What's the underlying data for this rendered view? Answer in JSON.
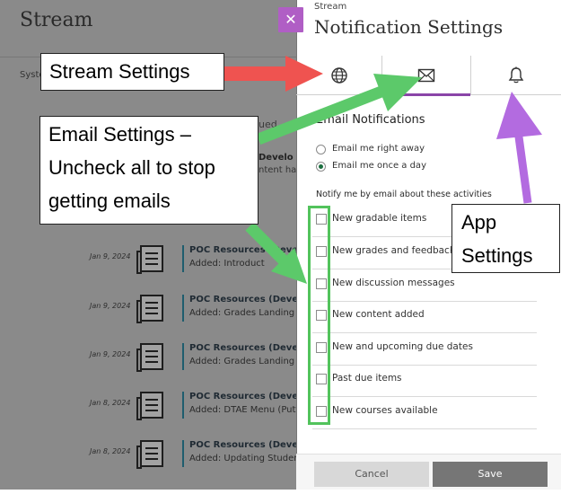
{
  "stream": {
    "title": "Stream",
    "system_tab": "Syste",
    "fragment_1": "ued",
    "fragment_2": "Develo",
    "fragment_3": "ntent has",
    "rows": [
      {
        "date": "Jan 9, 2024",
        "title": "POC Resources (Develo",
        "subtitle": "Added: Introduct"
      },
      {
        "date": "Jan 9, 2024",
        "title": "POC Resources (Develo",
        "subtitle": "Added: Grades Landing P"
      },
      {
        "date": "Jan 9, 2024",
        "title": "POC Resources (Develo",
        "subtitle": "Added: Grades Landing P"
      },
      {
        "date": "Jan 8, 2024",
        "title": "POC Resources (Develo",
        "subtitle": "Added: DTAE Menu (Putty"
      },
      {
        "date": "Jan 8, 2024",
        "title": "POC Resources (Develo",
        "subtitle": "Added: Updating Studen"
      }
    ]
  },
  "panel": {
    "close_glyph": "✕",
    "overline": "Stream",
    "title": "Notification Settings",
    "tabs": [
      {
        "icon": "globe-icon",
        "active": false
      },
      {
        "icon": "envelope-icon",
        "active": true
      },
      {
        "icon": "bell-icon",
        "active": false
      }
    ],
    "email_heading": "Email Notifications",
    "frequency_options": [
      {
        "label": "Email me right away",
        "selected": false
      },
      {
        "label": "Email me once a day",
        "selected": true
      }
    ],
    "notify_label": "Notify me by email about these activities",
    "activities": [
      {
        "label": "New gradable items",
        "checked": false
      },
      {
        "label": "New grades and feedback",
        "checked": false
      },
      {
        "label": "New discussion messages",
        "checked": false
      },
      {
        "label": "New content added",
        "checked": false
      },
      {
        "label": "New and upcoming due dates",
        "checked": false
      },
      {
        "label": "Past due items",
        "checked": false
      },
      {
        "label": "New courses available",
        "checked": false
      }
    ],
    "cancel_label": "Cancel",
    "save_label": "Save"
  },
  "annotations": {
    "stream_settings": "Stream Settings",
    "email_settings_lines": [
      "Email Settings –",
      "Uncheck all to stop",
      "getting emails"
    ],
    "app_settings_lines": [
      "App",
      "Settings"
    ],
    "colors": {
      "red": "#ef5350",
      "green": "#5cc96a",
      "purple": "#b36be0"
    }
  }
}
